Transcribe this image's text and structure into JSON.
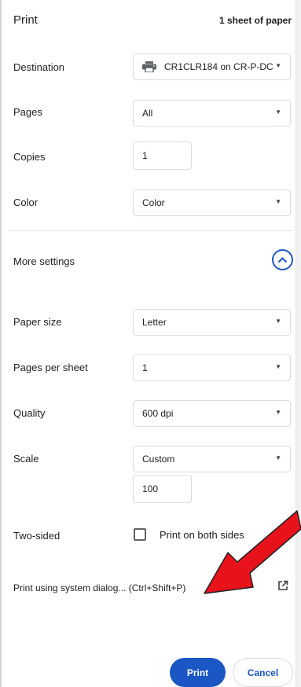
{
  "header": {
    "title": "Print",
    "sheet_count": "1 sheet of paper"
  },
  "destination": {
    "label": "Destination",
    "value": "CR1CLR184 on CR-P-DC",
    "icon": "printer-icon"
  },
  "pages": {
    "label": "Pages",
    "value": "All"
  },
  "copies": {
    "label": "Copies",
    "value": "1"
  },
  "color": {
    "label": "Color",
    "value": "Color"
  },
  "more_settings": {
    "label": "More settings",
    "icon": "chevron-up-icon",
    "expanded": true
  },
  "paper_size": {
    "label": "Paper size",
    "value": "Letter"
  },
  "pages_per_sheet": {
    "label": "Pages per sheet",
    "value": "1"
  },
  "quality": {
    "label": "Quality",
    "value": "600 dpi"
  },
  "scale": {
    "label": "Scale",
    "value": "Custom",
    "custom_value": "100"
  },
  "two_sided": {
    "label": "Two-sided",
    "checkbox_label": "Print on both sides",
    "checked": false
  },
  "system_dialog": {
    "label": "Print using system dialog... (Ctrl+Shift+P)",
    "icon": "open-in-new-icon"
  },
  "buttons": {
    "print": "Print",
    "cancel": "Cancel"
  },
  "colors": {
    "accent": "#1a56c4",
    "annotation_arrow": "#e8121a"
  }
}
